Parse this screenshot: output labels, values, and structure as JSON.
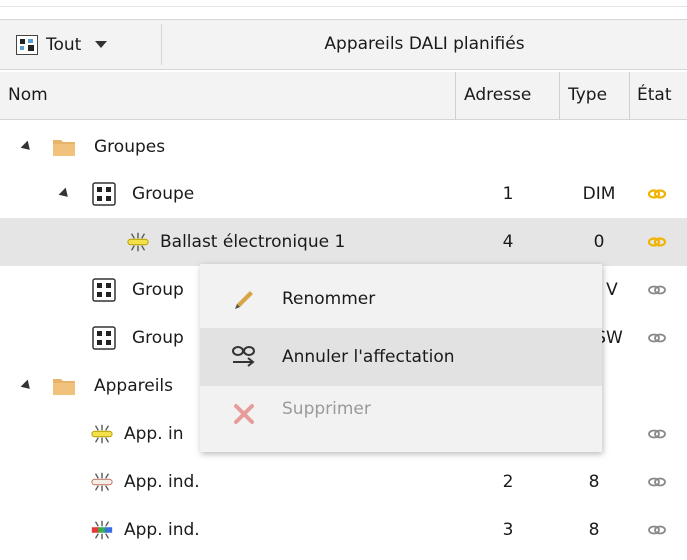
{
  "toolbar": {
    "filter_label": "Tout",
    "title": "Appareils DALI planifiés"
  },
  "columns": {
    "name": "Nom",
    "address": "Adresse",
    "type": "Type",
    "state": "État"
  },
  "rows": [
    {
      "label": "Groupes",
      "address": "",
      "type": ""
    },
    {
      "label": "Groupe",
      "address": "1",
      "type": "DIM"
    },
    {
      "label": "Ballast électronique 1",
      "address": "4",
      "type": "0"
    },
    {
      "label": "Group",
      "address": "",
      "type": "V"
    },
    {
      "label": "Group",
      "address": "",
      "type": "SW"
    },
    {
      "label": "Appareils",
      "address": "",
      "type": ""
    },
    {
      "label": "App. in",
      "address": "",
      "type": ""
    },
    {
      "label": "App. ind.",
      "address": "2",
      "type": "8"
    },
    {
      "label": "App. ind.",
      "address": "3",
      "type": "8"
    }
  ],
  "context_menu": {
    "rename": "Renommer",
    "unassign": "Annuler l'affectation",
    "delete": "Supprimer"
  },
  "colors": {
    "link_active": "#f0b400",
    "link_inactive": "#8a8a8a",
    "folder": "#e8b46a",
    "delete_disabled": "#e79b9b",
    "rename_pen": "#d9a445"
  },
  "icons": {
    "filter": "filter-grid-icon",
    "folder": "folder-icon",
    "group": "group-icon",
    "ballast": "ballast-lamp-icon",
    "link": "link-icon",
    "rename": "pencil-icon",
    "unassign": "unassign-icon",
    "delete": "x-icon"
  }
}
